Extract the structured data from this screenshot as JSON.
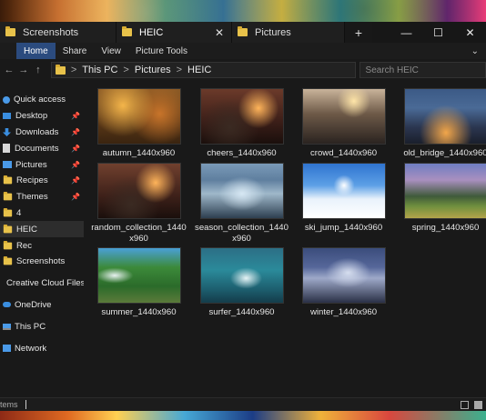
{
  "tabs": [
    {
      "label": "Screenshots",
      "close": ""
    },
    {
      "label": "HEIC",
      "close": "✕"
    },
    {
      "label": "Pictures",
      "close": ""
    }
  ],
  "new_tab": "+",
  "window_controls": {
    "minimize": "—",
    "maximize": "☐",
    "close": "✕"
  },
  "ribbon": {
    "home": "Home",
    "share": "Share",
    "view": "View",
    "picture_tools": "Picture Tools",
    "expand": "⌄"
  },
  "address": {
    "back": "←",
    "forward": "→",
    "up": "↑",
    "crumbs": [
      "This PC",
      "Pictures",
      "HEIC"
    ],
    "separator": ">",
    "search_placeholder": "Search HEIC"
  },
  "sidebar": {
    "items": [
      {
        "label": "Quick access",
        "icon": "star-icon"
      },
      {
        "label": "Desktop",
        "icon": "desktop-icon",
        "pinned": true
      },
      {
        "label": "Downloads",
        "icon": "download-icon",
        "pinned": true
      },
      {
        "label": "Documents",
        "icon": "document-icon",
        "pinned": true
      },
      {
        "label": "Pictures",
        "icon": "pictures-icon",
        "pinned": true
      },
      {
        "label": "Recipes",
        "icon": "folder-icon",
        "pinned": true
      },
      {
        "label": "Themes",
        "icon": "folder-icon",
        "pinned": true
      },
      {
        "label": "4",
        "icon": "folder-icon"
      },
      {
        "label": "HEIC",
        "icon": "folder-icon",
        "selected": true
      },
      {
        "label": "Rec",
        "icon": "folder-icon"
      },
      {
        "label": "Screenshots",
        "icon": "folder-icon"
      },
      {
        "label": "Creative Cloud Files",
        "icon": "creative-cloud-icon"
      },
      {
        "label": "OneDrive",
        "icon": "onedrive-icon"
      },
      {
        "label": "This PC",
        "icon": "pc-icon"
      },
      {
        "label": "Network",
        "icon": "network-icon"
      }
    ],
    "pin_glyph": "📌"
  },
  "files": [
    {
      "name": "autumn_1440x960",
      "thumb": "autumn"
    },
    {
      "name": "cheers_1440x960",
      "thumb": "cheers"
    },
    {
      "name": "crowd_1440x960",
      "thumb": "crowd"
    },
    {
      "name": "old_bridge_1440x960",
      "thumb": "bridge"
    },
    {
      "name": "random_collection_1440x960",
      "thumb": "random"
    },
    {
      "name": "season_collection_1440x960",
      "thumb": "season"
    },
    {
      "name": "ski_jump_1440x960",
      "thumb": "ski"
    },
    {
      "name": "spring_1440x960",
      "thumb": "spring"
    },
    {
      "name": "summer_1440x960",
      "thumb": "summer"
    },
    {
      "name": "surfer_1440x960",
      "thumb": "surfer"
    },
    {
      "name": "winter_1440x960",
      "thumb": "winter"
    }
  ],
  "status": {
    "text": "tems"
  }
}
